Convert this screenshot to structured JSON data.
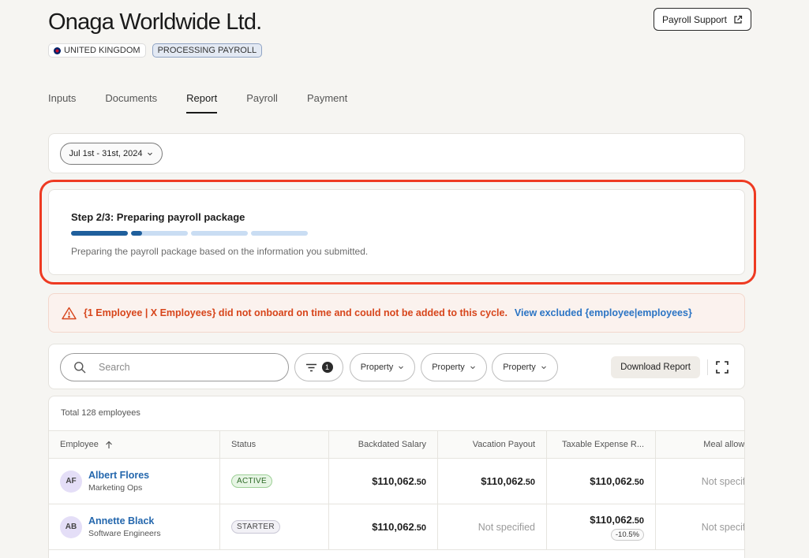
{
  "header": {
    "title": "Onaga Worldwide Ltd.",
    "support_label": "Payroll Support",
    "badges": {
      "country": "UNITED KINGDOM",
      "status": "PROCESSING PAYROLL"
    }
  },
  "tabs": [
    {
      "label": "Inputs"
    },
    {
      "label": "Documents"
    },
    {
      "label": "Report",
      "active": true
    },
    {
      "label": "Payroll"
    },
    {
      "label": "Payment"
    }
  ],
  "date_range": "Jul 1st - 31st, 2024",
  "step": {
    "title": "Step 2/3: Preparing payroll package",
    "description": "Preparing the payroll package based on the information you submitted.",
    "current_step": 2,
    "total_steps": 4
  },
  "alert": {
    "message": "{1 Employee | X Employees} did not onboard on time and could not be added to this cycle.",
    "link": "View excluded {employee|employees}"
  },
  "toolbar": {
    "search_placeholder": "Search",
    "filter_count": "1",
    "properties": [
      "Property",
      "Property",
      "Property"
    ],
    "download_label": "Download Report"
  },
  "table": {
    "total": "Total 128 employees",
    "columns": [
      "Employee",
      "Status",
      "Backdated Salary",
      "Vacation Payout",
      "Taxable Expense R...",
      "Meal allowanc"
    ],
    "rows": [
      {
        "initials": "AF",
        "name": "Albert Flores",
        "dept": "Marketing Ops",
        "status": "ACTIVE",
        "backdated_main": "$110,062",
        "backdated_cents": ".50",
        "vacation_main": "$110,062",
        "vacation_cents": ".50",
        "taxable_main": "$110,062",
        "taxable_cents": ".50",
        "meal": "Not specified"
      },
      {
        "initials": "AB",
        "name": "Annette Black",
        "dept": "Software Engineers",
        "status": "STARTER",
        "backdated_main": "$110,062",
        "backdated_cents": ".50",
        "vacation": "Not specified",
        "taxable_main": "$110,062",
        "taxable_cents": ".50",
        "taxable_delta": "-10.5%",
        "meal": "Not specified"
      }
    ]
  }
}
